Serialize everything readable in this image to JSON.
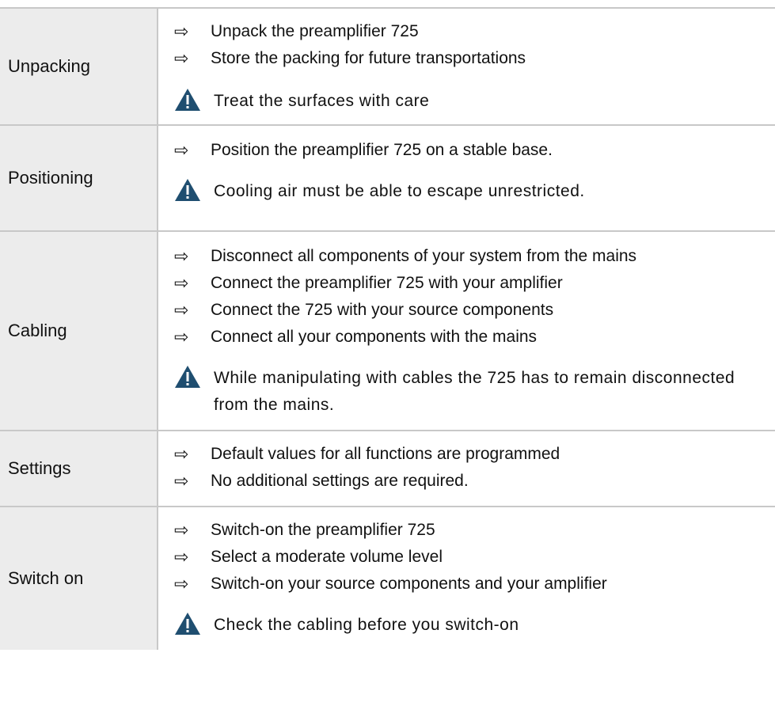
{
  "sections": [
    {
      "label": "Unpacking",
      "bullets": [
        "Unpack the preamplifier 725",
        "Store the packing for future transportations"
      ],
      "warning": "Treat the surfaces with care"
    },
    {
      "label": "Positioning",
      "bullets": [
        "Position the preamplifier 725 on a stable base."
      ],
      "warning": "Cooling air must be able to escape unrestricted."
    },
    {
      "label": "Cabling",
      "bullets": [
        "Disconnect all components of your system from the mains",
        "Connect the preamplifier 725 with your amplifier",
        "Connect the 725 with your source components",
        "Connect all your components with the mains"
      ],
      "warning": "While manipulating with cables the 725 has to remain disconnected from the mains."
    },
    {
      "label": "Settings",
      "bullets": [
        "Default values for all functions are programmed",
        "No additional settings are required."
      ],
      "warning": ""
    },
    {
      "label": "Switch on",
      "bullets": [
        "Switch-on the preamplifier 725",
        "Select a moderate volume level",
        "Switch-on your source components and your amplifier"
      ],
      "warning": "Check the cabling before you switch-on"
    }
  ],
  "icons": {
    "bullet": "arrow-right-icon",
    "warning": "warning-triangle-icon"
  },
  "colors": {
    "warning": "#1f4e70",
    "label_bg": "#ececec",
    "rule": "#c8c8c8"
  }
}
